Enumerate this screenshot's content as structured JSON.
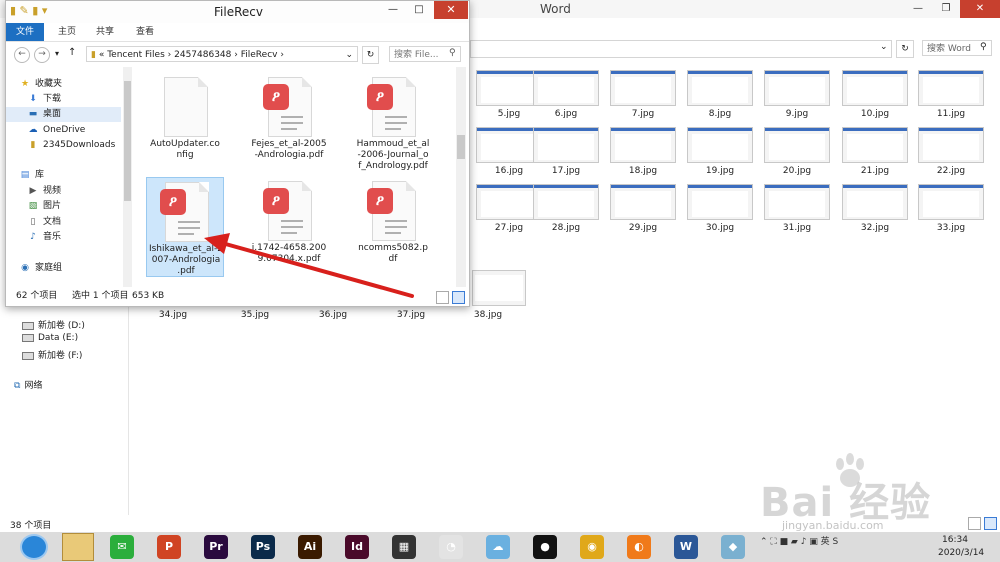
{
  "background_window": {
    "title": "Word",
    "controls": {
      "minimize": "—",
      "restore": "❐",
      "close": "✕"
    },
    "search_placeholder": "搜索 Word",
    "thumbnails_row1": [
      "5.jpg",
      "6.jpg",
      "7.jpg",
      "8.jpg",
      "9.jpg",
      "10.jpg",
      "11.jpg"
    ],
    "thumbnails_row2": [
      "16.jpg",
      "17.jpg",
      "18.jpg",
      "19.jpg",
      "20.jpg",
      "21.jpg",
      "22.jpg"
    ],
    "thumbnails_row3": [
      "27.jpg",
      "28.jpg",
      "29.jpg",
      "30.jpg",
      "31.jpg",
      "32.jpg",
      "33.jpg"
    ],
    "thumbnails_row4": [
      "34.jpg",
      "35.jpg",
      "36.jpg",
      "37.jpg",
      "38.jpg"
    ],
    "drives": [
      "新加卷 (D:)",
      "Data (E:)",
      "新加卷 (F:)"
    ],
    "network_label": "网络",
    "status": "38 个项目"
  },
  "foreground_window": {
    "title": "FileRecv",
    "close_glyph": "✕",
    "min_glyph": "—",
    "max_glyph": "□",
    "ribbon_tabs": [
      "文件",
      "主页",
      "共享",
      "查看"
    ],
    "path": {
      "prefix": "«",
      "segments": [
        "Tencent Files",
        "2457486348",
        "FileRecv"
      ],
      "separator": "›"
    },
    "search_placeholder": "搜索 File...",
    "nav_pane": {
      "favorites_header": "收藏夹",
      "favorites": [
        "下载",
        "桌面"
      ],
      "onedrive": "OneDrive",
      "downloads2345": "2345Downloads",
      "libraries_header": "库",
      "libraries": [
        "视频",
        "图片",
        "文档",
        "音乐"
      ],
      "homegroup": "家庭组"
    },
    "files": [
      {
        "name": "AutoUpdater.config",
        "label_lines": [
          "AutoUpdater.co",
          "nfig"
        ],
        "type": "blank",
        "selected": false
      },
      {
        "name": "Fejes_et_al-2005-Andrologia.pdf",
        "label_lines": [
          "Fejes_et_al-2005",
          "-Andrologia.pdf"
        ],
        "type": "pdf",
        "selected": false
      },
      {
        "name": "Hammoud_et_al-2006-Journal_of_Andrology.pdf",
        "label_lines": [
          "Hammoud_et_al",
          "-2006-Journal_o",
          "f_Andrology.pdf"
        ],
        "type": "pdf",
        "selected": false
      },
      {
        "name": "Ishikawa_et_al-2007-Andrologia.pdf",
        "label_lines": [
          "Ishikawa_et_al-2",
          "007-Andrologia",
          ".pdf"
        ],
        "type": "pdf",
        "selected": true
      },
      {
        "name": "j.1742-4658.2009.07304.x.pdf",
        "label_lines": [
          "j.1742-4658.200",
          "9.07304.x.pdf"
        ],
        "type": "pdf",
        "selected": false
      },
      {
        "name": "ncomms5082.pdf",
        "label_lines": [
          "ncomms5082.p",
          "df"
        ],
        "type": "pdf",
        "selected": false
      }
    ],
    "status": {
      "count": "62 个项目",
      "selected": "选中 1 个项目",
      "size": "653 KB"
    }
  },
  "taskbar": {
    "apps": [
      {
        "name": "wechat",
        "glyph": "✉",
        "color": "#2bae3c"
      },
      {
        "name": "powerpoint",
        "glyph": "P",
        "color": "#d04423"
      },
      {
        "name": "premiere",
        "glyph": "Pr",
        "color": "#2a0a3e"
      },
      {
        "name": "photoshop",
        "glyph": "Ps",
        "color": "#0b2a4a"
      },
      {
        "name": "illustrator",
        "glyph": "Ai",
        "color": "#3a1a00"
      },
      {
        "name": "indesign",
        "glyph": "Id",
        "color": "#4a0a2a"
      },
      {
        "name": "video-editor",
        "glyph": "▦",
        "color": "#333333"
      },
      {
        "name": "photo-app",
        "glyph": "◔",
        "color": "#e3e3e3"
      },
      {
        "name": "cloud-app",
        "glyph": "☁",
        "color": "#6ab0e0"
      },
      {
        "name": "qq",
        "glyph": "●",
        "color": "#111111"
      },
      {
        "name": "chrome",
        "glyph": "◉",
        "color": "#e0a81a"
      },
      {
        "name": "browser-orange",
        "glyph": "◐",
        "color": "#f07a1a"
      },
      {
        "name": "word",
        "glyph": "W",
        "color": "#2b5797"
      },
      {
        "name": "generic-app",
        "glyph": "◆",
        "color": "#7ab0d0"
      }
    ],
    "tray_glyphs": "⌃ ⛶ ■ ▰ ♪ ▣ 英 S",
    "time": "16:34",
    "date": "2020/3/14"
  },
  "watermark": {
    "logo": "Bai 经验",
    "url": "jingyan.baidu.com"
  },
  "colors": {
    "accent_blue": "#1d6fc2",
    "close_red": "#c7402e",
    "pdf_red": "#e14d4d",
    "arrow_red": "#d8201c"
  }
}
